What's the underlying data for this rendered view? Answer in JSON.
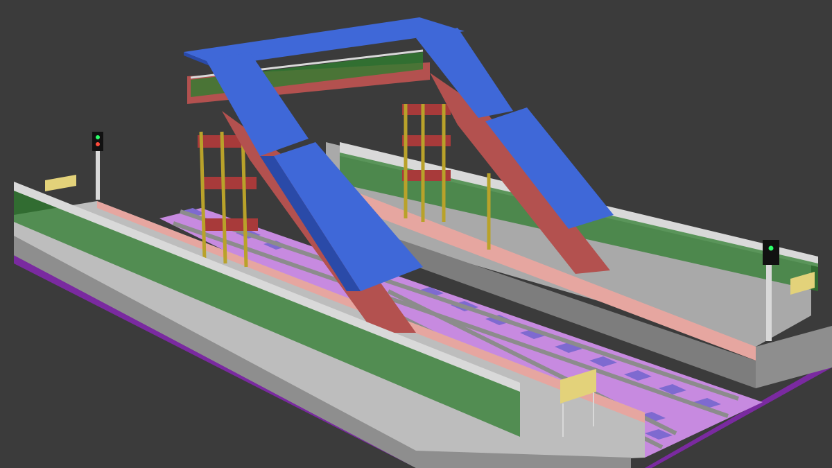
{
  "scene": {
    "background": "#3b3b3b",
    "colors": {
      "roof": "#3f68d8",
      "roof_dark": "#2a4aa8",
      "stairs": "#b3514f",
      "platform_top": "#bdbdbd",
      "platform_side": "#8e8e8e",
      "platform_edge": "#e6a6a0",
      "track_bed": "#c78ae0",
      "rail": "#8c8c8c",
      "sleeper": "#7e6ad0",
      "fence": "#2f7d2f",
      "rail_post": "#d9d9d9",
      "pillar": "#b9a22a",
      "frame": "#a83a3a",
      "base_trim": "#7a2aa0",
      "sign": "#e3d27a",
      "signal_light_green": "#2cff6a",
      "signal_light_red": "#ff4a3a"
    },
    "objects": [
      "foot-overbridge",
      "stair-roof-left",
      "stair-roof-right",
      "railway-tracks",
      "platform-left",
      "platform-right",
      "railing-fence",
      "signal-post-left",
      "signal-post-right",
      "station-sign"
    ]
  }
}
